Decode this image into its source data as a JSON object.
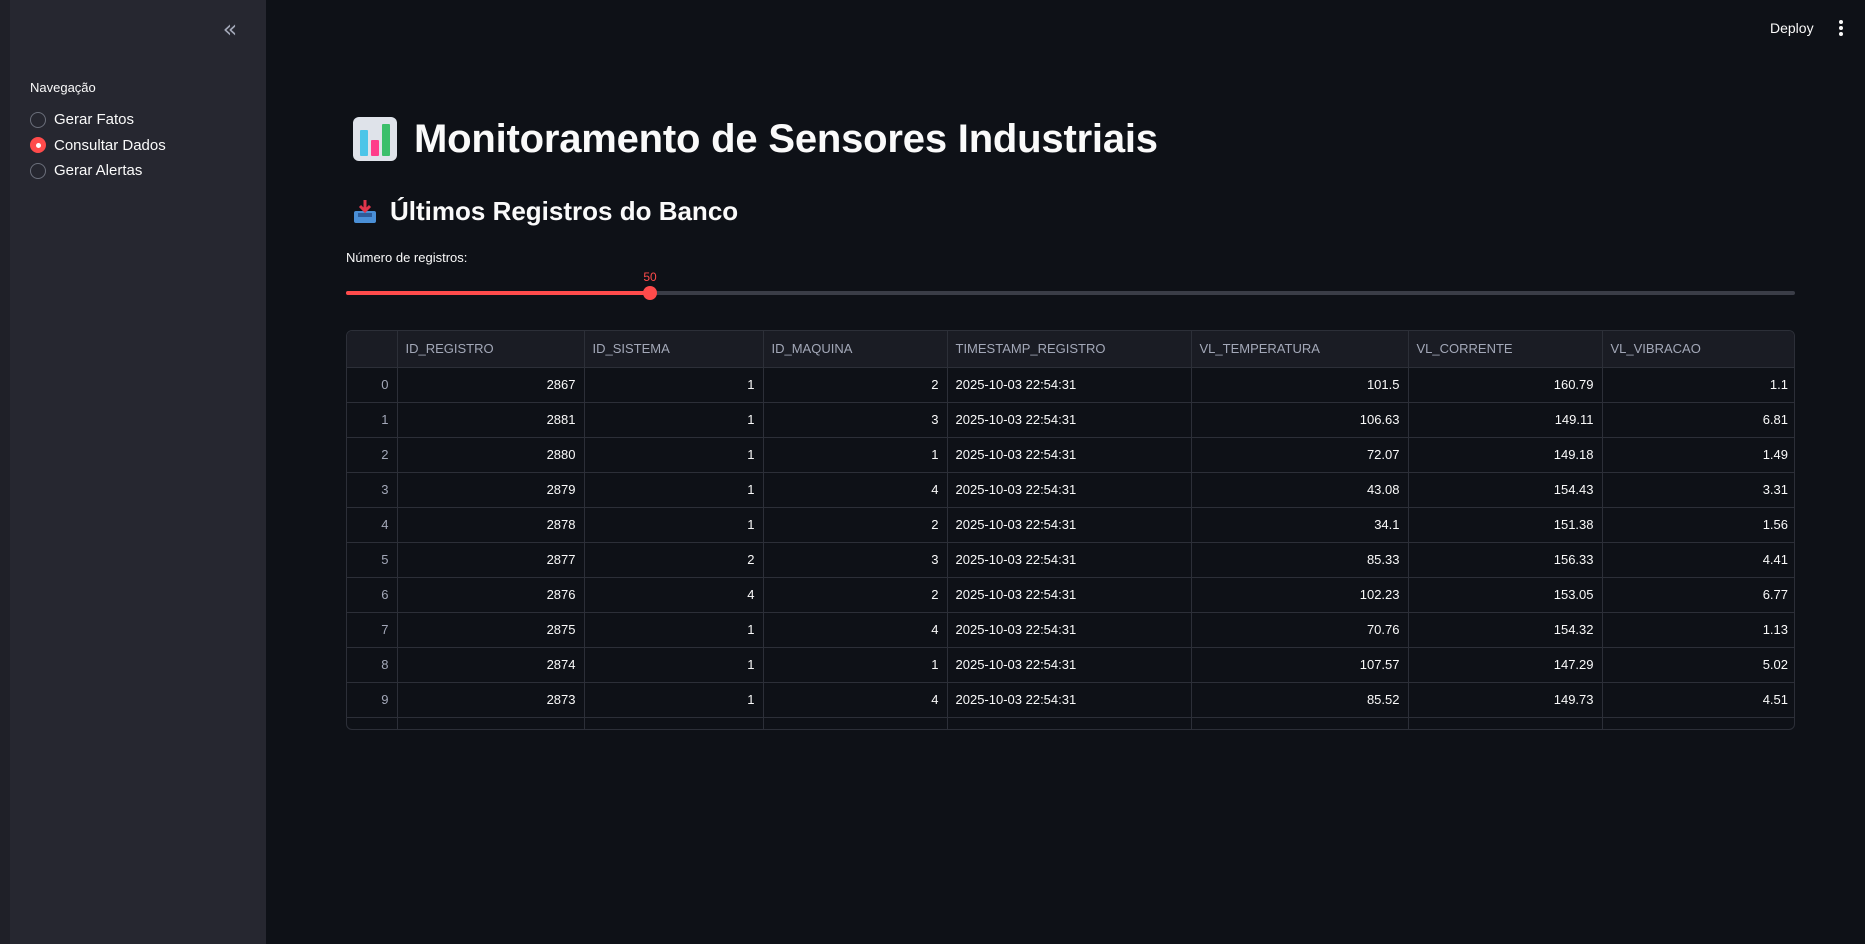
{
  "sidebar": {
    "collapse_icon": "double-chevron-left-icon",
    "nav_label": "Navegação",
    "options": [
      {
        "label": "Gerar Fatos",
        "selected": false
      },
      {
        "label": "Consultar Dados",
        "selected": true
      },
      {
        "label": "Gerar Alertas",
        "selected": false
      }
    ]
  },
  "header": {
    "deploy_label": "Deploy",
    "menu_icon": "vertical-dots-icon"
  },
  "main": {
    "title": "Monitoramento de Sensores Industriais",
    "title_icon": "bar-chart-icon",
    "subtitle": "Últimos Registros do Banco",
    "subtitle_icon": "inbox-tray-icon",
    "slider": {
      "label": "Número de registros:",
      "value": "50",
      "fraction": 0.21
    }
  },
  "table": {
    "columns": [
      "",
      "ID_REGISTRO",
      "ID_SISTEMA",
      "ID_MAQUINA",
      "TIMESTAMP_REGISTRO",
      "VL_TEMPERATURA",
      "VL_CORRENTE",
      "VL_VIBRACAO"
    ],
    "rows": [
      [
        "0",
        "2867",
        "1",
        "2",
        "2025-10-03 22:54:31",
        "101.5",
        "160.79",
        "1.1"
      ],
      [
        "1",
        "2881",
        "1",
        "3",
        "2025-10-03 22:54:31",
        "106.63",
        "149.11",
        "6.81"
      ],
      [
        "2",
        "2880",
        "1",
        "1",
        "2025-10-03 22:54:31",
        "72.07",
        "149.18",
        "1.49"
      ],
      [
        "3",
        "2879",
        "1",
        "4",
        "2025-10-03 22:54:31",
        "43.08",
        "154.43",
        "3.31"
      ],
      [
        "4",
        "2878",
        "1",
        "2",
        "2025-10-03 22:54:31",
        "34.1",
        "151.38",
        "1.56"
      ],
      [
        "5",
        "2877",
        "2",
        "3",
        "2025-10-03 22:54:31",
        "85.33",
        "156.33",
        "4.41"
      ],
      [
        "6",
        "2876",
        "4",
        "2",
        "2025-10-03 22:54:31",
        "102.23",
        "153.05",
        "6.77"
      ],
      [
        "7",
        "2875",
        "1",
        "4",
        "2025-10-03 22:54:31",
        "70.76",
        "154.32",
        "1.13"
      ],
      [
        "8",
        "2874",
        "1",
        "1",
        "2025-10-03 22:54:31",
        "107.57",
        "147.29",
        "5.02"
      ],
      [
        "9",
        "2873",
        "1",
        "4",
        "2025-10-03 22:54:31",
        "85.52",
        "149.73",
        "4.51"
      ]
    ]
  },
  "colors": {
    "accent": "#ff4b4b",
    "background": "#0e1117",
    "sidebar": "#262730"
  }
}
